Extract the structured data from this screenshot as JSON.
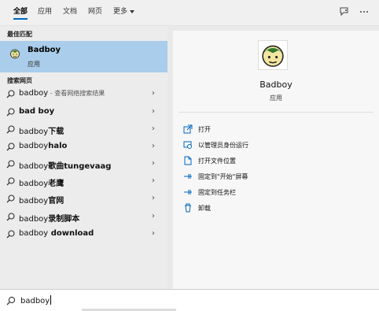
{
  "tabs": [
    {
      "label": "全部",
      "active": true
    },
    {
      "label": "应用"
    },
    {
      "label": "文档"
    },
    {
      "label": "网页"
    },
    {
      "label": "更多"
    }
  ],
  "header_icons": [
    "feedback-icon",
    "more-options-icon"
  ],
  "left": {
    "best_match_title": "最佳匹配",
    "best_match": {
      "name": "Badboy",
      "type": "应用",
      "icon": "badboy-app-icon"
    },
    "web_title": "搜索网页",
    "web_results": [
      {
        "text": "badboy",
        "hint": " - 查看网络搜索结果",
        "bold": false
      },
      {
        "text": "bad boy",
        "hint": "",
        "bold": true
      },
      {
        "prefix": "badboy",
        "suffix": "下载"
      },
      {
        "prefix": "badboy",
        "suffix": "halo"
      },
      {
        "prefix": "badboy",
        "suffix": "歌曲tungevaag"
      },
      {
        "prefix": "badboy",
        "suffix": "老鹰"
      },
      {
        "prefix": "badboy",
        "suffix": "官网"
      },
      {
        "prefix": "badboy",
        "suffix": "录制脚本"
      },
      {
        "prefix": "badboy",
        "suffix": " download"
      }
    ]
  },
  "right": {
    "app_name": "Badboy",
    "app_type": "应用",
    "actions": [
      {
        "label": "打开",
        "icon": "open-icon"
      },
      {
        "label": "以管理员身份运行",
        "icon": "admin-shield-icon"
      },
      {
        "label": "打开文件位置",
        "icon": "file-location-icon"
      },
      {
        "label": "固定到\"开始\"屏幕",
        "icon": "pin-start-icon"
      },
      {
        "label": "固定到任务栏",
        "icon": "pin-taskbar-icon"
      },
      {
        "label": "卸载",
        "icon": "trash-icon"
      }
    ]
  },
  "search": {
    "value": "badboy"
  },
  "colors": {
    "accent": "#0067c0",
    "selected": "#a9cdea"
  }
}
